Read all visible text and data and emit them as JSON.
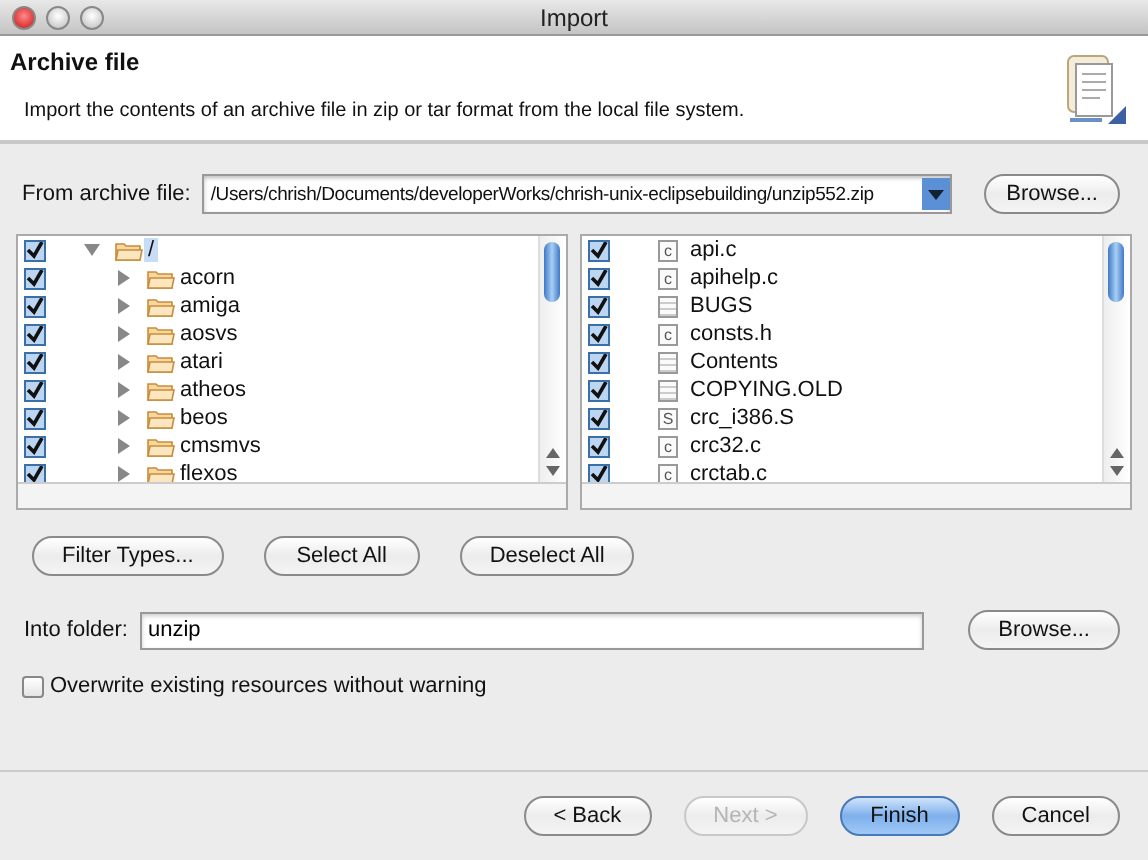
{
  "window": {
    "title": "Import"
  },
  "header": {
    "title": "Archive file",
    "description": "Import the contents of an archive file in zip or tar format from the local file system."
  },
  "archive": {
    "label": "From archive file:",
    "value": "/Users/chrish/Documents/developerWorks/chrish-unix-eclipsebuilding/unzip552.zip",
    "browse": "Browse..."
  },
  "folder_tree": [
    {
      "name": "/",
      "checked": true,
      "expanded": true,
      "selected": true,
      "children": [
        {
          "name": "acorn",
          "checked": true,
          "expanded": false,
          "selected": false
        },
        {
          "name": "amiga",
          "checked": true,
          "expanded": false,
          "selected": false
        },
        {
          "name": "aosvs",
          "checked": true,
          "expanded": false,
          "selected": false
        },
        {
          "name": "atari",
          "checked": true,
          "expanded": false,
          "selected": false
        },
        {
          "name": "atheos",
          "checked": true,
          "expanded": false,
          "selected": false
        },
        {
          "name": "beos",
          "checked": true,
          "expanded": false,
          "selected": false
        },
        {
          "name": "cmsmvs",
          "checked": true,
          "expanded": false,
          "selected": false
        },
        {
          "name": "flexos",
          "checked": true,
          "expanded": false,
          "selected": false
        }
      ]
    }
  ],
  "files": [
    {
      "name": "api.c",
      "checked": true,
      "kind": "lettered",
      "icon_text": "c"
    },
    {
      "name": "apihelp.c",
      "checked": true,
      "kind": "lettered",
      "icon_text": "c"
    },
    {
      "name": "BUGS",
      "checked": true,
      "kind": "plain"
    },
    {
      "name": "consts.h",
      "checked": true,
      "kind": "lettered",
      "icon_text": "c"
    },
    {
      "name": "Contents",
      "checked": true,
      "kind": "plain"
    },
    {
      "name": "COPYING.OLD",
      "checked": true,
      "kind": "plain"
    },
    {
      "name": "crc_i386.S",
      "checked": true,
      "kind": "lettered",
      "icon_text": "S"
    },
    {
      "name": "crc32.c",
      "checked": true,
      "kind": "lettered",
      "icon_text": "c"
    },
    {
      "name": "crctab.c",
      "checked": true,
      "kind": "lettered",
      "icon_text": "c"
    }
  ],
  "selection_buttons": [
    "Filter Types...",
    "Select All",
    "Deselect All"
  ],
  "into_folder": {
    "label": "Into folder:",
    "value": "unzip",
    "browse": "Browse..."
  },
  "overwrite": {
    "label": "Overwrite existing resources without warning",
    "checked": false
  },
  "footer_buttons": [
    {
      "label": "< Back",
      "disabled": false,
      "default": false
    },
    {
      "label": "Next >",
      "disabled": true,
      "default": false
    },
    {
      "label": "Finish",
      "disabled": false,
      "default": true
    },
    {
      "label": "Cancel",
      "disabled": false,
      "default": false
    }
  ]
}
